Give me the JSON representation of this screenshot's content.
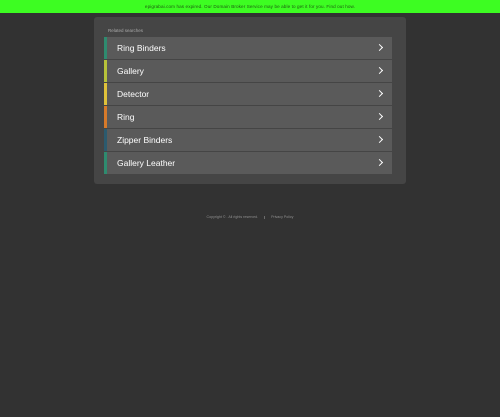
{
  "banner": {
    "text": "epigrabai.com has expired. Our Domain Broker Service may be able to get it for you. Find out how."
  },
  "panel": {
    "heading": "Related searches",
    "links": [
      {
        "label": "Ring Binders",
        "accent": "#2e8b6f",
        "icon": "chevron-right-icon"
      },
      {
        "label": "Gallery",
        "accent": "#b6c23a",
        "icon": "chevron-right-icon"
      },
      {
        "label": "Detector",
        "accent": "#e0c23a",
        "icon": "chevron-right-icon"
      },
      {
        "label": "Ring",
        "accent": "#d77a2a",
        "icon": "chevron-right-icon"
      },
      {
        "label": "Zipper Binders",
        "accent": "#2b5a6e",
        "icon": "chevron-right-icon"
      },
      {
        "label": "Gallery Leather",
        "accent": "#2e8b6f",
        "icon": "chevron-right-icon"
      }
    ]
  },
  "footer": {
    "copyright": "Copyright © . All rights reserved.",
    "privacy": "Privacy Policy"
  },
  "colors": {
    "background": "#323232",
    "panel": "#454545",
    "link_bg": "#5a5a5a",
    "banner": "#3dfd22"
  }
}
